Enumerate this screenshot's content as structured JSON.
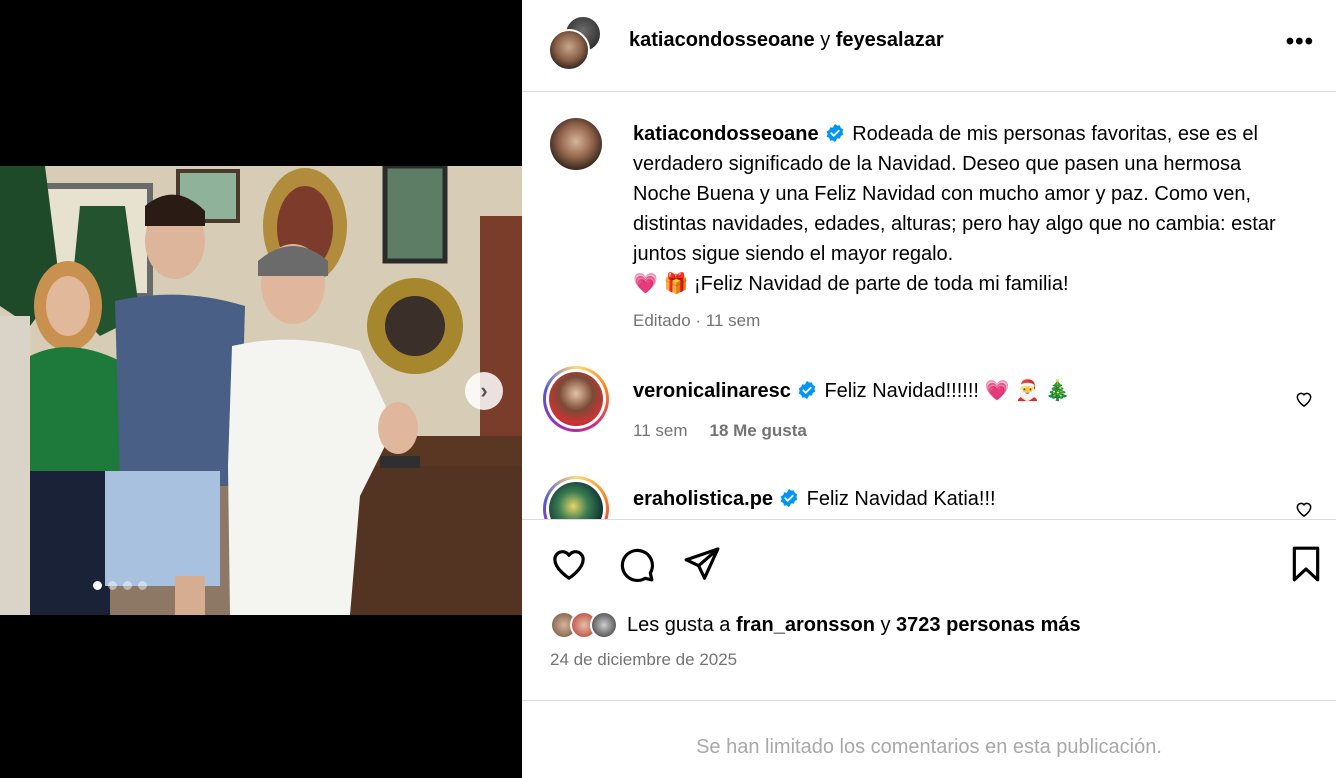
{
  "post": {
    "author": "katiacondosseoane",
    "conjunction": "y",
    "collaborator": "feyesalazar",
    "more_icon": "more-horizontal-icon"
  },
  "caption": {
    "username": "katiacondosseoane",
    "text": "Rodeada de mis personas favoritas, ese es el verdadero significado de la Navidad. Deseo que pasen una hermosa Noche Buena y una Feliz Navidad con mucho amor y paz. Como ven, distintas navidades, edades, alturas; pero hay algo que no cambia: estar juntos sigue siendo el mayor regalo.",
    "emoji_line": "💗 🎁",
    "closing": "¡Feliz Navidad de parte de toda mi familia!",
    "edited": "Editado",
    "separator": "·",
    "time": "11 sem"
  },
  "comments": [
    {
      "username": "veronicalinaresc",
      "text": "Feliz Navidad!!!!!! 💗 🎅 🎄",
      "time": "11 sem",
      "likes": "18 Me gusta"
    },
    {
      "username": "eraholistica.pe",
      "text": "Feliz Navidad Katia!!!"
    }
  ],
  "likes": {
    "prefix": "Les gusta a",
    "user": "fran_aronsson",
    "conj": "y",
    "others": "3723 personas más"
  },
  "date": "24 de diciembre de 2025",
  "comments_limited": "Se han limitado los comentarios en esta publicación.",
  "carousel": {
    "current_slide": 1,
    "total_slides": 4
  },
  "colors": {
    "verified": "#0095f6",
    "muted": "#737373",
    "border": "#dbdbdb"
  }
}
